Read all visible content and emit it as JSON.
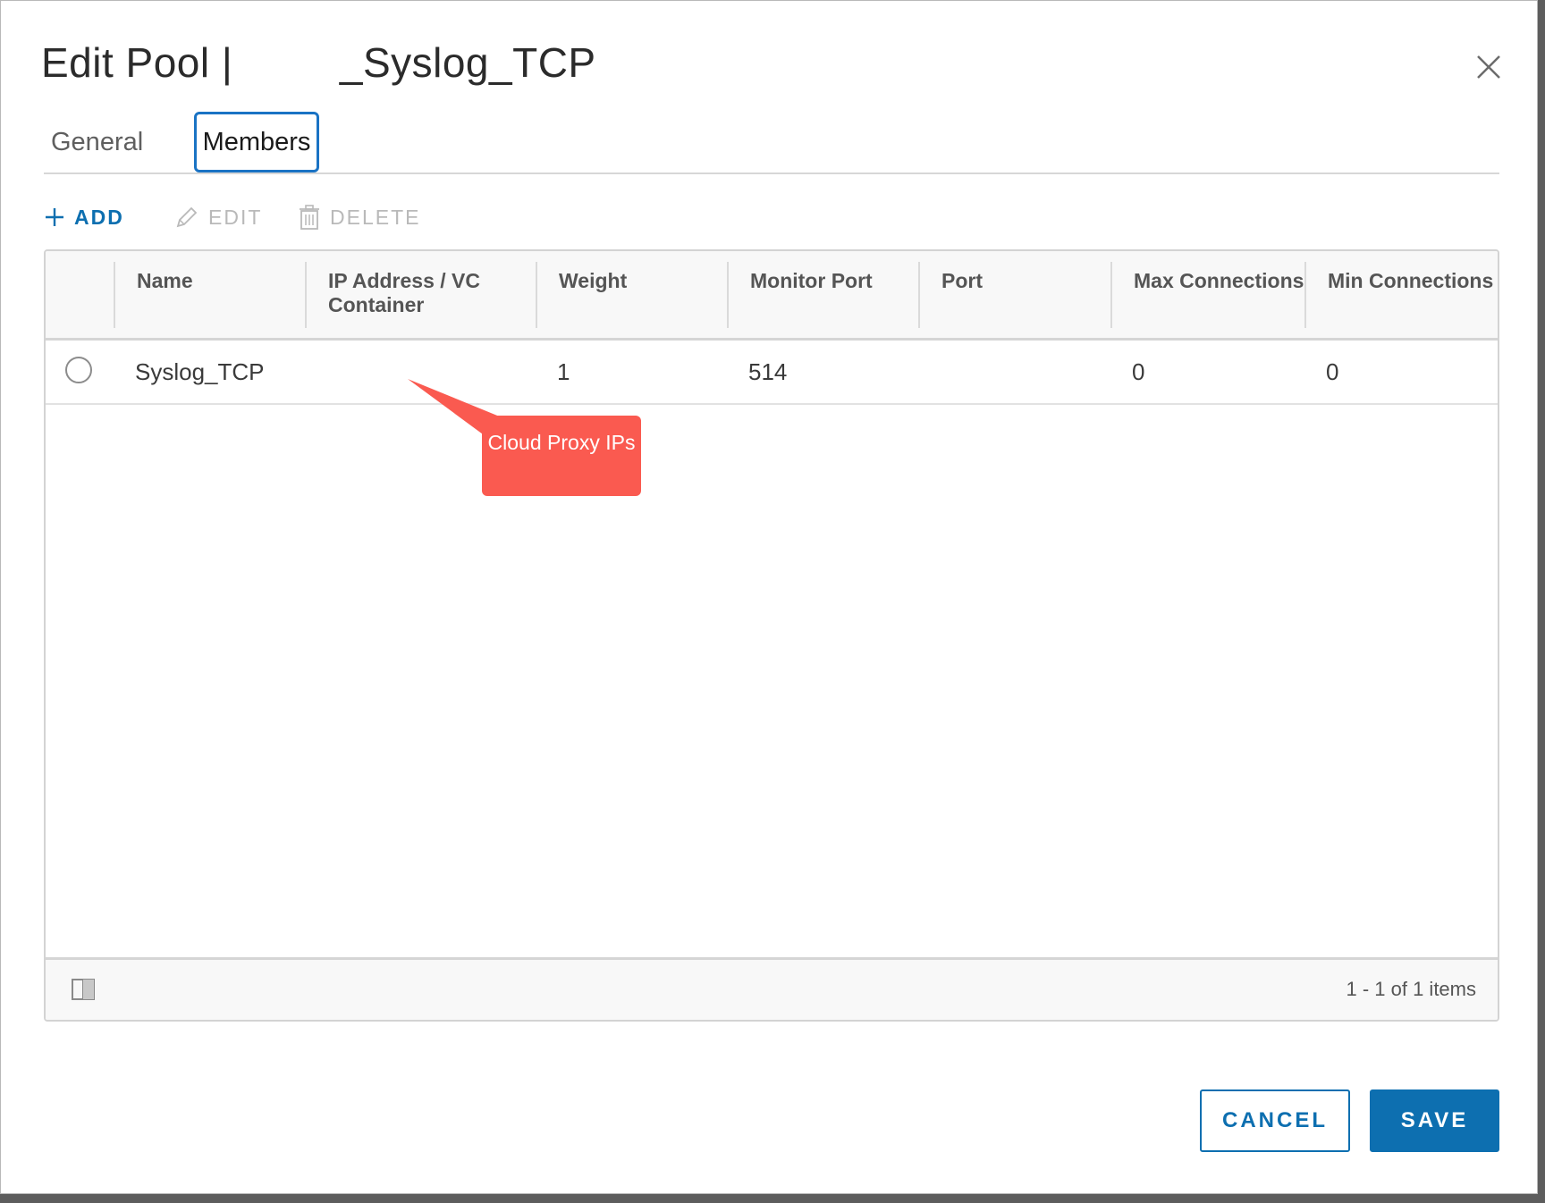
{
  "dialog": {
    "title": "Edit Pool |         _Syslog_TCP"
  },
  "tabs": [
    {
      "label": "General"
    },
    {
      "label": "Members"
    }
  ],
  "toolbar": {
    "add_label": "ADD",
    "edit_label": "EDIT",
    "delete_label": "DELETE"
  },
  "table": {
    "columns": [
      "Name",
      "IP Address / VC Container",
      "Weight",
      "Monitor Port",
      "Port",
      "Max Connections",
      "Min Connections"
    ],
    "rows": [
      {
        "name": "Syslog_TCP",
        "ip": "",
        "weight": "1",
        "monitor_port": "514",
        "port": "",
        "max_connections": "0",
        "min_connections": "0"
      }
    ],
    "pagination": "1 - 1 of 1 items"
  },
  "callout": {
    "text": "Cloud Proxy IPs",
    "color": "#fa5a50"
  },
  "footer": {
    "cancel_label": "CANCEL",
    "save_label": "SAVE"
  },
  "colors": {
    "accent": "#0d6fb0",
    "tab_focus": "#1a73c4"
  }
}
